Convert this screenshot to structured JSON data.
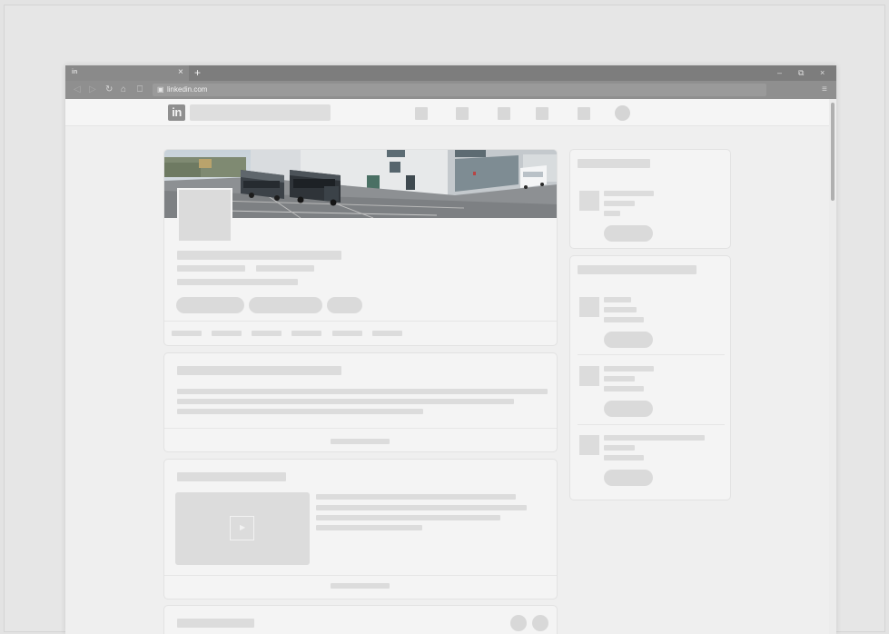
{
  "browser": {
    "tab_favicon": "in",
    "tab_close": "×",
    "new_tab": "+",
    "window_controls": {
      "minimize": "–",
      "restore": "⧉",
      "close": "×"
    },
    "nav_icons": [
      "back-icon",
      "forward-icon",
      "reload-icon",
      "home-icon",
      "bookmark-icon"
    ],
    "url": "linkedin.com",
    "lock_icon": "🔒",
    "menu_icon": "≡"
  },
  "linkedin": {
    "logo_text": "in"
  },
  "profile": {
    "banner": "photo of coaches parked outside a modern grey building"
  },
  "video": {
    "play_glyph": "▶"
  },
  "colors": {
    "chrome_dark": "#7d7d7d",
    "placeholder": "#dcdcdc",
    "card_bg": "#f4f4f4"
  }
}
